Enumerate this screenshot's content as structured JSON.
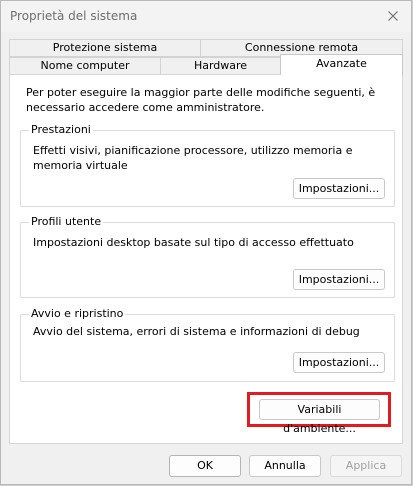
{
  "window": {
    "title": "Proprietà del sistema",
    "close_label": "✕"
  },
  "tabs": {
    "row1": [
      {
        "label": "Protezione sistema"
      },
      {
        "label": "Connessione remota"
      }
    ],
    "row2": [
      {
        "label": "Nome computer"
      },
      {
        "label": "Hardware"
      },
      {
        "label": "Avanzate",
        "selected": true
      }
    ]
  },
  "advanced": {
    "intro": "Per poter eseguire la maggior parte delle modifiche seguenti, è necessario accedere come amministratore.",
    "groups": [
      {
        "title": "Prestazioni",
        "description": "Effetti visivi, pianificazione processore, utilizzo memoria e memoria virtuale",
        "button": "Impostazioni..."
      },
      {
        "title": "Profili utente",
        "description": "Impostazioni desktop basate sul tipo di accesso effettuato",
        "button": "Impostazioni..."
      },
      {
        "title": "Avvio e ripristino",
        "description": "Avvio del sistema, errori di sistema e informazioni di debug",
        "button": "Impostazioni..."
      }
    ],
    "env_button": "Variabili d'ambiente..."
  },
  "footer": {
    "ok": "OK",
    "cancel": "Annulla",
    "apply": "Applica"
  },
  "colors": {
    "highlight": "#e01b24"
  }
}
